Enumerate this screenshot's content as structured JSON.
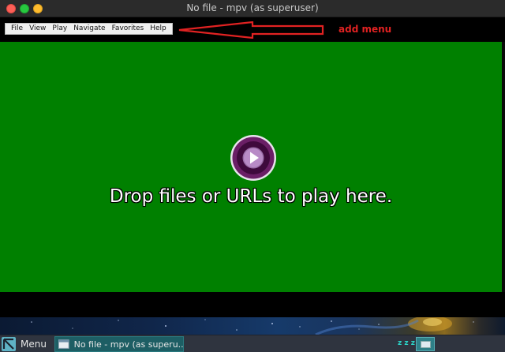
{
  "window": {
    "title": "No file - mpv (as superuser)"
  },
  "menubar": {
    "items": [
      "File",
      "View",
      "Play",
      "Navigate",
      "Favorites",
      "Help"
    ]
  },
  "annotation": {
    "label": "add menu",
    "color": "#e12222"
  },
  "player": {
    "drop_message": "Drop files or URLs to play here.",
    "background_color": "#008000",
    "logo_icon": "mpv-logo-icon"
  },
  "taskbar": {
    "start_label": "Menu",
    "task_label": "No file - mpv (as superu...",
    "tray_sleep_text": "z z z",
    "accent": "#1d5e64"
  }
}
